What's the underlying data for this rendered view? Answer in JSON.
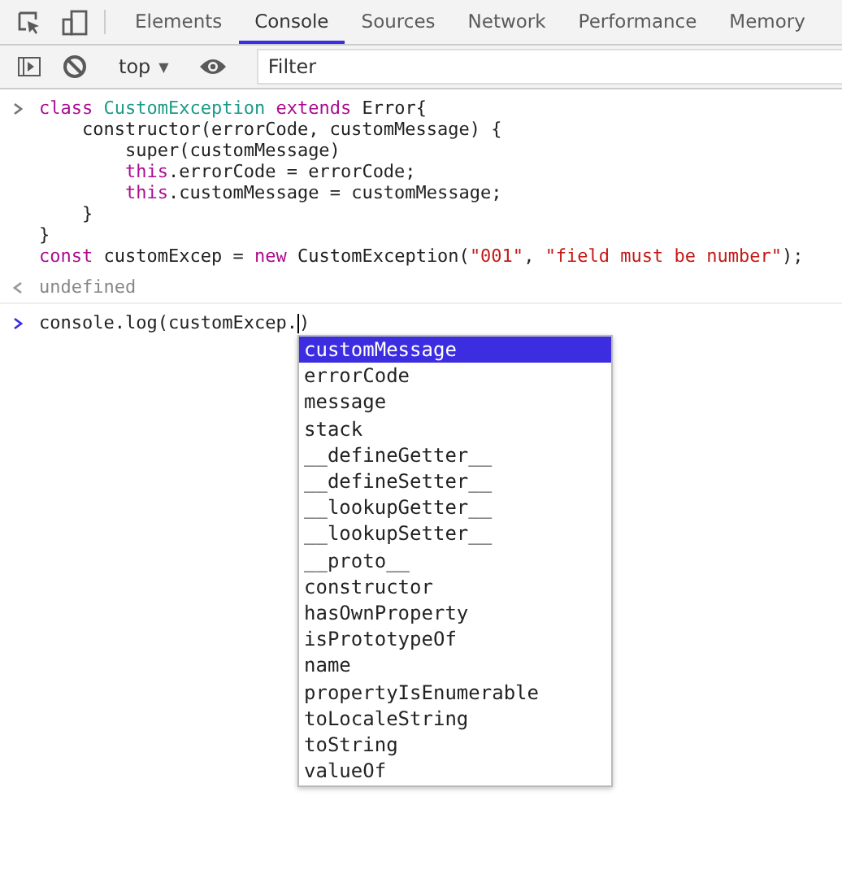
{
  "tabs": [
    {
      "label": "Elements",
      "selected": false
    },
    {
      "label": "Console",
      "selected": true
    },
    {
      "label": "Sources",
      "selected": false
    },
    {
      "label": "Network",
      "selected": false
    },
    {
      "label": "Performance",
      "selected": false
    },
    {
      "label": "Memory",
      "selected": false
    }
  ],
  "toolbar": {
    "context": "top",
    "context_caret": "▼",
    "filter": {
      "placeholder": "Filter"
    }
  },
  "entry": {
    "lines": [
      [
        {
          "kind": "keyword",
          "text": "class "
        },
        {
          "kind": "class",
          "text": "CustomException "
        },
        {
          "kind": "keyword",
          "text": "extends "
        },
        {
          "kind": "plain",
          "text": "Error{"
        }
      ],
      [
        {
          "kind": "plain",
          "text": "    constructor(errorCode, customMessage) {"
        }
      ],
      [
        {
          "kind": "plain",
          "text": "        super(customMessage)"
        }
      ],
      [
        {
          "kind": "keyword",
          "text": "        this"
        },
        {
          "kind": "plain",
          "text": ".errorCode = errorCode;"
        }
      ],
      [
        {
          "kind": "keyword",
          "text": "        this"
        },
        {
          "kind": "plain",
          "text": ".customMessage = customMessage;"
        }
      ],
      [
        {
          "kind": "plain",
          "text": "    }"
        }
      ],
      [
        {
          "kind": "plain",
          "text": "}"
        }
      ],
      [
        {
          "kind": "keyword",
          "text": "const "
        },
        {
          "kind": "plain",
          "text": "customExcep = "
        },
        {
          "kind": "keyword",
          "text": "new "
        },
        {
          "kind": "plain",
          "text": "CustomException("
        },
        {
          "kind": "string",
          "text": "\"001\""
        },
        {
          "kind": "plain",
          "text": ", "
        },
        {
          "kind": "string",
          "text": "\"field must be number\""
        },
        {
          "kind": "plain",
          "text": ");"
        }
      ]
    ]
  },
  "result": "undefined",
  "prompt": {
    "before_cursor": "console.log(customExcep.",
    "after_cursor": ")"
  },
  "suggestions": [
    {
      "label": "customMessage",
      "selected": true
    },
    {
      "label": "errorCode",
      "selected": false
    },
    {
      "label": "message",
      "selected": false
    },
    {
      "label": "stack",
      "selected": false
    },
    {
      "label": "__defineGetter__",
      "selected": false
    },
    {
      "label": "__defineSetter__",
      "selected": false
    },
    {
      "label": "__lookupGetter__",
      "selected": false
    },
    {
      "label": "__lookupSetter__",
      "selected": false
    },
    {
      "label": "__proto__",
      "selected": false
    },
    {
      "label": "constructor",
      "selected": false
    },
    {
      "label": "hasOwnProperty",
      "selected": false
    },
    {
      "label": "isPrototypeOf",
      "selected": false
    },
    {
      "label": "name",
      "selected": false
    },
    {
      "label": "propertyIsEnumerable",
      "selected": false
    },
    {
      "label": "toLocaleString",
      "selected": false
    },
    {
      "label": "toString",
      "selected": false
    },
    {
      "label": "valueOf",
      "selected": false
    }
  ]
}
